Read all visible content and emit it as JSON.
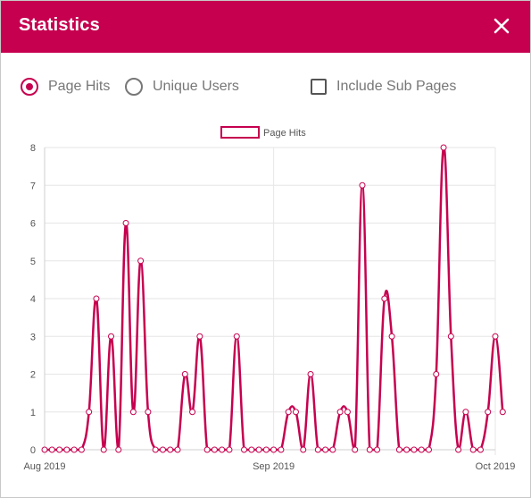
{
  "dialog": {
    "title": "Statistics",
    "close_icon": "close-icon"
  },
  "options": {
    "page_hits_label": "Page Hits",
    "unique_users_label": "Unique Users",
    "include_sub_pages_label": "Include Sub Pages",
    "selected": "Page Hits",
    "include_sub_pages_checked": false
  },
  "colors": {
    "accent": "#c6004f",
    "grid": "#e6e6e6",
    "axis_text": "#555555"
  },
  "chart_data": {
    "type": "line",
    "legend": "Page Hits",
    "legend_position": "top-center",
    "grid": true,
    "ylim": [
      0,
      8
    ],
    "y_ticks": [
      "0",
      "1",
      "2",
      "3",
      "4",
      "5",
      "6",
      "7",
      "8"
    ],
    "x_ticks": [
      "Aug 2019",
      "Sep 2019",
      "Oct 2019"
    ],
    "x_tick_days": [
      0,
      31,
      61
    ],
    "series": [
      {
        "name": "Page Hits",
        "x": [
          0,
          1,
          2,
          3,
          4,
          5,
          6,
          7,
          8,
          9,
          10,
          11,
          12,
          13,
          14,
          15,
          16,
          17,
          18,
          19,
          20,
          21,
          22,
          23,
          24,
          25,
          26,
          27,
          28,
          29,
          30,
          31,
          32,
          33,
          34,
          35,
          36,
          37,
          38,
          39,
          40,
          41,
          42,
          43,
          44,
          45,
          46,
          47,
          48,
          49,
          50,
          51,
          52,
          53,
          54,
          55,
          56,
          57,
          58,
          59,
          60,
          61,
          62
        ],
        "values": [
          0,
          0,
          0,
          0,
          0,
          0,
          1,
          4,
          0,
          3,
          0,
          6,
          1,
          5,
          1,
          0,
          0,
          0,
          0,
          2,
          1,
          3,
          0,
          0,
          0,
          0,
          3,
          0,
          0,
          0,
          0,
          0,
          0,
          1,
          1,
          0,
          2,
          0,
          0,
          0,
          1,
          1,
          0,
          7,
          0,
          0,
          4,
          3,
          0,
          0,
          0,
          0,
          0,
          2,
          8,
          3,
          0,
          1,
          0,
          0,
          1,
          3,
          1
        ]
      }
    ]
  }
}
